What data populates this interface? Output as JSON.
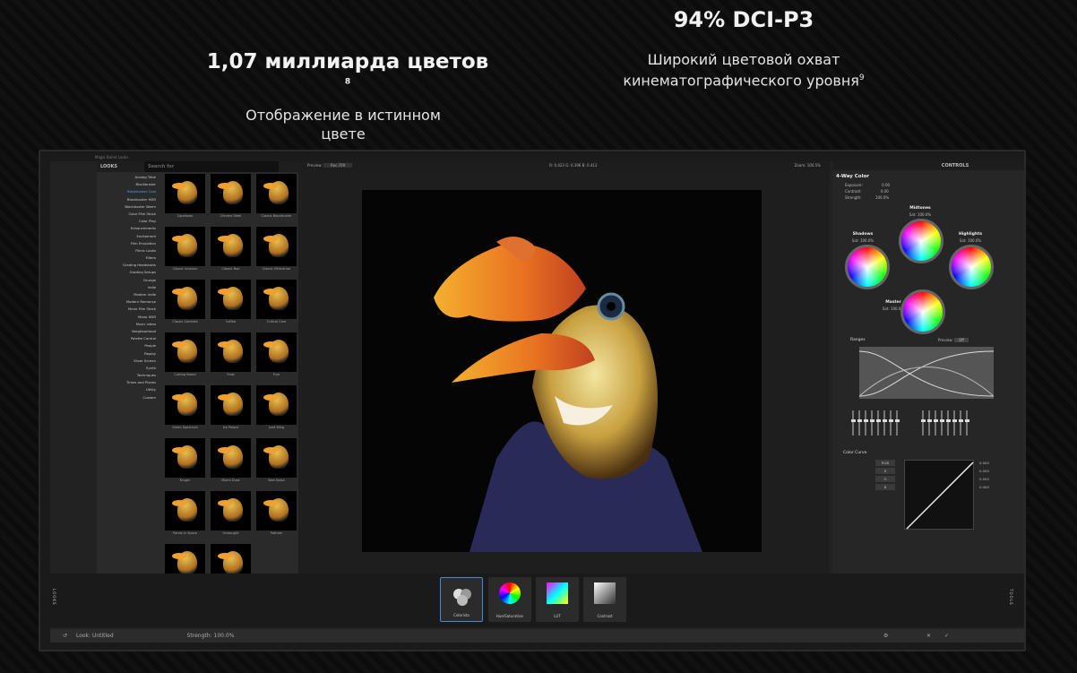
{
  "marketing": {
    "left_title": "1,07 миллиарда цветов",
    "left_sup": "8",
    "left_sub": "Отображение в истинном цвете",
    "right_title": "94% DCI-P3",
    "right_sub_1": "Широкий цветовой охват",
    "right_sub_2": "кинематографического уровня",
    "right_sup": "9"
  },
  "app": {
    "title": "Magic Bullet Looks",
    "looks_header": "LOOKS",
    "search_placeholder": "Search for",
    "categories": [
      "Analog Tribe",
      "Blockbuster",
      "Blockbuster Cool",
      "Blockbuster HDR",
      "Blockbuster Warm",
      "Color Film Stock",
      "Color Play",
      "Enhancements",
      "Excitement",
      "Film Emulation",
      "Filmic Looks",
      "Filters",
      "Grading Headstarts",
      "Grading Setups",
      "Grunge",
      "Indie",
      "Modern Indie",
      "Modern Romance",
      "Mono Film Stock",
      "Mono HDR",
      "Music video",
      "Neighborhood",
      "Palette Control",
      "People",
      "Replay",
      "Silver Screen",
      "Synth",
      "Techniques",
      "Times and Places",
      "Utility",
      "Custom"
    ],
    "selected_category": "Blockbuster Cool",
    "thumbs": [
      "Capetown",
      "Chrome Steel",
      "Classic Blockbuster",
      "Classic Invasion",
      "Classic Neo",
      "Classic Ultimatum",
      "Classic Zombies",
      "Coffee",
      "Critical Care",
      "Cutting Board",
      "Frost",
      "Frye",
      "Green Spectrum",
      "Ice Palace",
      "Iced Wing",
      "Kruger",
      "Miami Dusk",
      "New Noise",
      "Pando in Space",
      "Onslaught",
      "Potham",
      "",
      ""
    ],
    "preview_label": "Preview:",
    "preview_value": "Rec.709",
    "readout": "R: 0.423   G: 0.396   B: 0.412",
    "zoom": "Zoom: 100.5%",
    "controls_header": "CONTROLS",
    "panel_title": "4-Way Color",
    "exposure_label": "Exposure:",
    "exposure_value": "0.00",
    "contrast_label": "Contrast:",
    "contrast_value": "0.00",
    "strength_label": "Strength:",
    "strength_value": "100.0%",
    "wheels": [
      {
        "name": "Midtones",
        "sat": "Sat: 100.0%"
      },
      {
        "name": "Shadows",
        "sat": "Sat: 100.0%"
      },
      {
        "name": "Highlights",
        "sat": "Sat: 100.0%"
      },
      {
        "name": "Master",
        "sat": "Sat: 100.0%"
      }
    ],
    "ranges_label": "Ranges",
    "ranges_preview_label": "Preview:",
    "ranges_preview_value": "Off",
    "curve_label": "Color Curve",
    "curve_channels": [
      "RGB",
      "R",
      "G",
      "B"
    ],
    "curve_values": [
      "0.000",
      "0.000",
      "0.000",
      "0.000"
    ],
    "tools": [
      "Colorista",
      "Hue/Saturation",
      "LUT",
      "Contrast"
    ],
    "side_left": "LOOKS",
    "side_right": "TOOLS",
    "status_look_label": "Look:",
    "status_look_value": "Untitled",
    "status_strength_label": "Strength:",
    "status_strength_value": "100.0%"
  }
}
